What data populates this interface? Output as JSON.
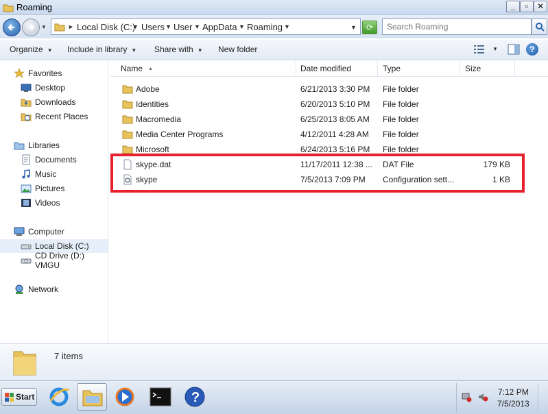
{
  "window": {
    "title": "Roaming"
  },
  "address": {
    "crumbs": [
      "Local Disk (C:)",
      "Users",
      "User",
      "AppData",
      "Roaming"
    ],
    "search_placeholder": "Search Roaming"
  },
  "toolbar": {
    "organize": "Organize",
    "include_in_library": "Include in library",
    "share_with": "Share with",
    "new_folder": "New folder"
  },
  "nav": {
    "favorites": "Favorites",
    "desktop": "Desktop",
    "downloads": "Downloads",
    "recent_places": "Recent Places",
    "libraries": "Libraries",
    "documents": "Documents",
    "music": "Music",
    "pictures": "Pictures",
    "videos": "Videos",
    "computer": "Computer",
    "local_disk": "Local Disk (C:)",
    "cd_drive": "CD Drive (D:) VMGU",
    "network": "Network"
  },
  "columns": {
    "name": "Name",
    "date": "Date modified",
    "type": "Type",
    "size": "Size"
  },
  "files": [
    {
      "name": "Adobe",
      "date": "6/21/2013 3:30 PM",
      "type": "File folder",
      "size": "",
      "icon": "folder-icon"
    },
    {
      "name": "Identities",
      "date": "6/20/2013 5:10 PM",
      "type": "File folder",
      "size": "",
      "icon": "folder-icon"
    },
    {
      "name": "Macromedia",
      "date": "6/25/2013 8:05 AM",
      "type": "File folder",
      "size": "",
      "icon": "folder-icon"
    },
    {
      "name": "Media Center Programs",
      "date": "4/12/2011 4:28 AM",
      "type": "File folder",
      "size": "",
      "icon": "folder-icon"
    },
    {
      "name": "Microsoft",
      "date": "6/24/2013 5:16 PM",
      "type": "File folder",
      "size": "",
      "icon": "folder-icon"
    },
    {
      "name": "skype.dat",
      "date": "11/17/2011 12:38 ...",
      "type": "DAT File",
      "size": "179 KB",
      "icon": "file-icon"
    },
    {
      "name": "skype",
      "date": "7/5/2013 7:09 PM",
      "type": "Configuration sett...",
      "size": "1 KB",
      "icon": "config-file-icon"
    }
  ],
  "details": {
    "count": "7 items"
  },
  "taskbar": {
    "start": "Start",
    "time": "7:12 PM",
    "date": "7/5/2013"
  },
  "colors": {
    "highlight": "#e8202e",
    "accent": "#2a64b0"
  }
}
